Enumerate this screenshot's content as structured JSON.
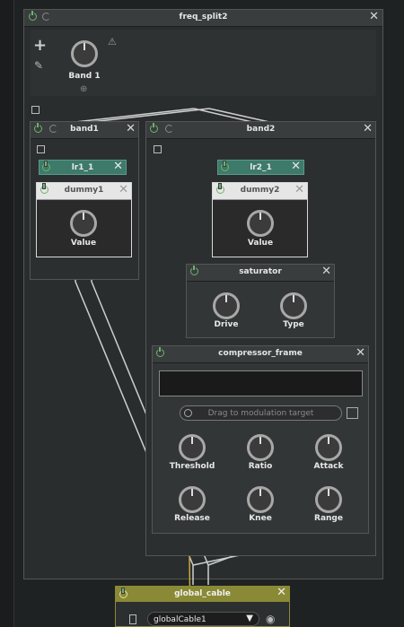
{
  "freq_split": {
    "title": "freq_split2",
    "band_knob_label": "Band 1"
  },
  "band1": {
    "title": "band1",
    "lr": "lr1_1",
    "dummy": "dummy1",
    "value_label": "Value"
  },
  "band2": {
    "title": "band2",
    "lr": "lr2_1",
    "dummy": "dummy2",
    "value_label": "Value"
  },
  "saturator": {
    "title": "saturator",
    "knobs": [
      "Drive",
      "Type"
    ]
  },
  "compressor": {
    "title": "compressor_frame",
    "drag_text": "Drag to modulation target",
    "knobs": [
      "Threshold",
      "Ratio",
      "Attack",
      "Release",
      "Knee",
      "Range"
    ]
  },
  "global_cable": {
    "title": "global_cable",
    "cable_name": "globalCable1"
  },
  "colors": {
    "accent": "#6fb26f",
    "lr_bg": "#3e7a69",
    "cable_bg": "#8a8a36",
    "cable_wire": "#c9a640"
  }
}
